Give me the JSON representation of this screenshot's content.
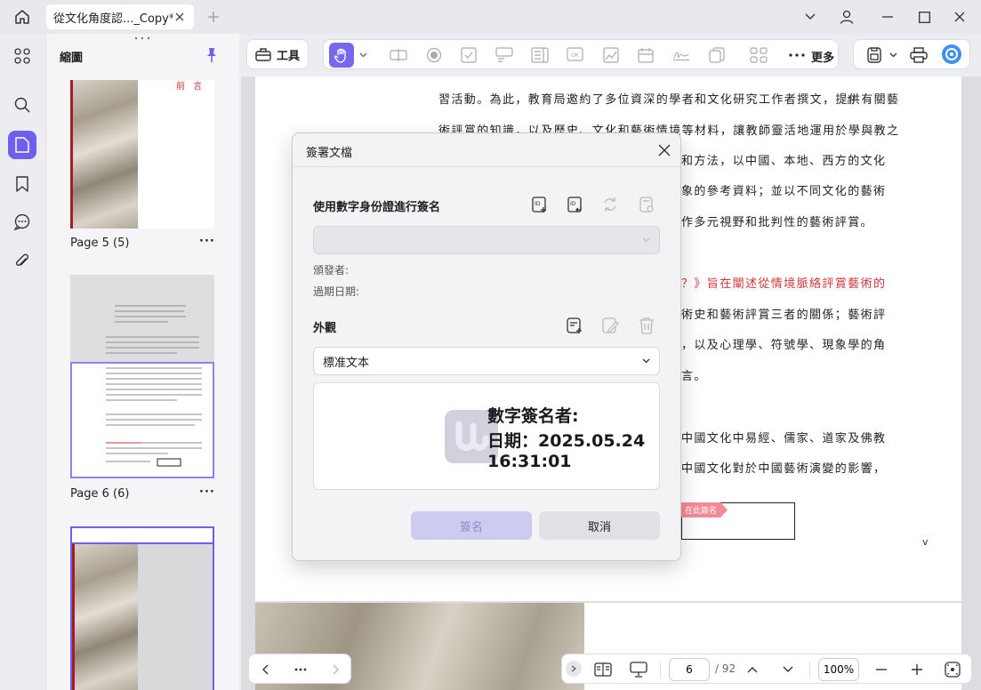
{
  "tab": {
    "title": "從文化角度認..._Copy*"
  },
  "thumbnails": {
    "title": "縮圖",
    "pages": [
      {
        "label": "Page 5 (5)",
        "heading": "前 言"
      },
      {
        "label": "Page 6 (6)"
      }
    ]
  },
  "toolbar": {
    "tools_label": "工具",
    "more_label": "更多"
  },
  "document": {
    "lines": [
      {
        "text": "習活動。為此，教育局邀約了多位資深的學者和文化研究工作者撰文，提供有關藝",
        "red": false
      },
      {
        "text": "術評賞的知識，以及歷史、文化和藝術情境等材料，讓教師靈活地運用於學與教之",
        "red": false
      },
      {
        "text": "和方法，以中國、本地、西方的文化",
        "red": false,
        "indent": true
      },
      {
        "text": "象的參考資料；並以不同文化的藝術",
        "red": false,
        "indent": true
      },
      {
        "text": "作多元視野和批判性的藝術評賞。",
        "red": false,
        "indent": true
      },
      {
        "text": "？》旨在闡述從情境脈絡評賞藝術的",
        "red": true,
        "indent": true
      },
      {
        "text": "術史和藝術評賞三者的關係；藝術評",
        "red": false,
        "indent": true
      },
      {
        "text": "，以及心理學、符號學、現象學的角",
        "red": false,
        "indent": true
      },
      {
        "text": "言。",
        "red": false,
        "indent": true
      },
      {
        "text": "中國文化中易經、儒家、道家及佛教",
        "red": false,
        "indent": true
      },
      {
        "text": "中國文化對於中國藝術演變的影響，",
        "red": false,
        "indent": true
      }
    ],
    "sign_here": "在此簽名",
    "footer_char": "v"
  },
  "status": {
    "current_page": "6",
    "total_pages": "/ 92",
    "zoom": "100%"
  },
  "dialog": {
    "title": "簽署文檔",
    "digital_id_section": "使用數字身份證進行簽名",
    "issuer_label": "頒發者:",
    "expiry_label": "過期日期:",
    "appearance_section": "外觀",
    "appearance_value": "標准文本",
    "signature_line1": "數字簽名者:",
    "signature_line2": "日期：2025.05.24",
    "signature_line3": "16:31:01",
    "sign_button": "簽名",
    "cancel_button": "取消"
  }
}
